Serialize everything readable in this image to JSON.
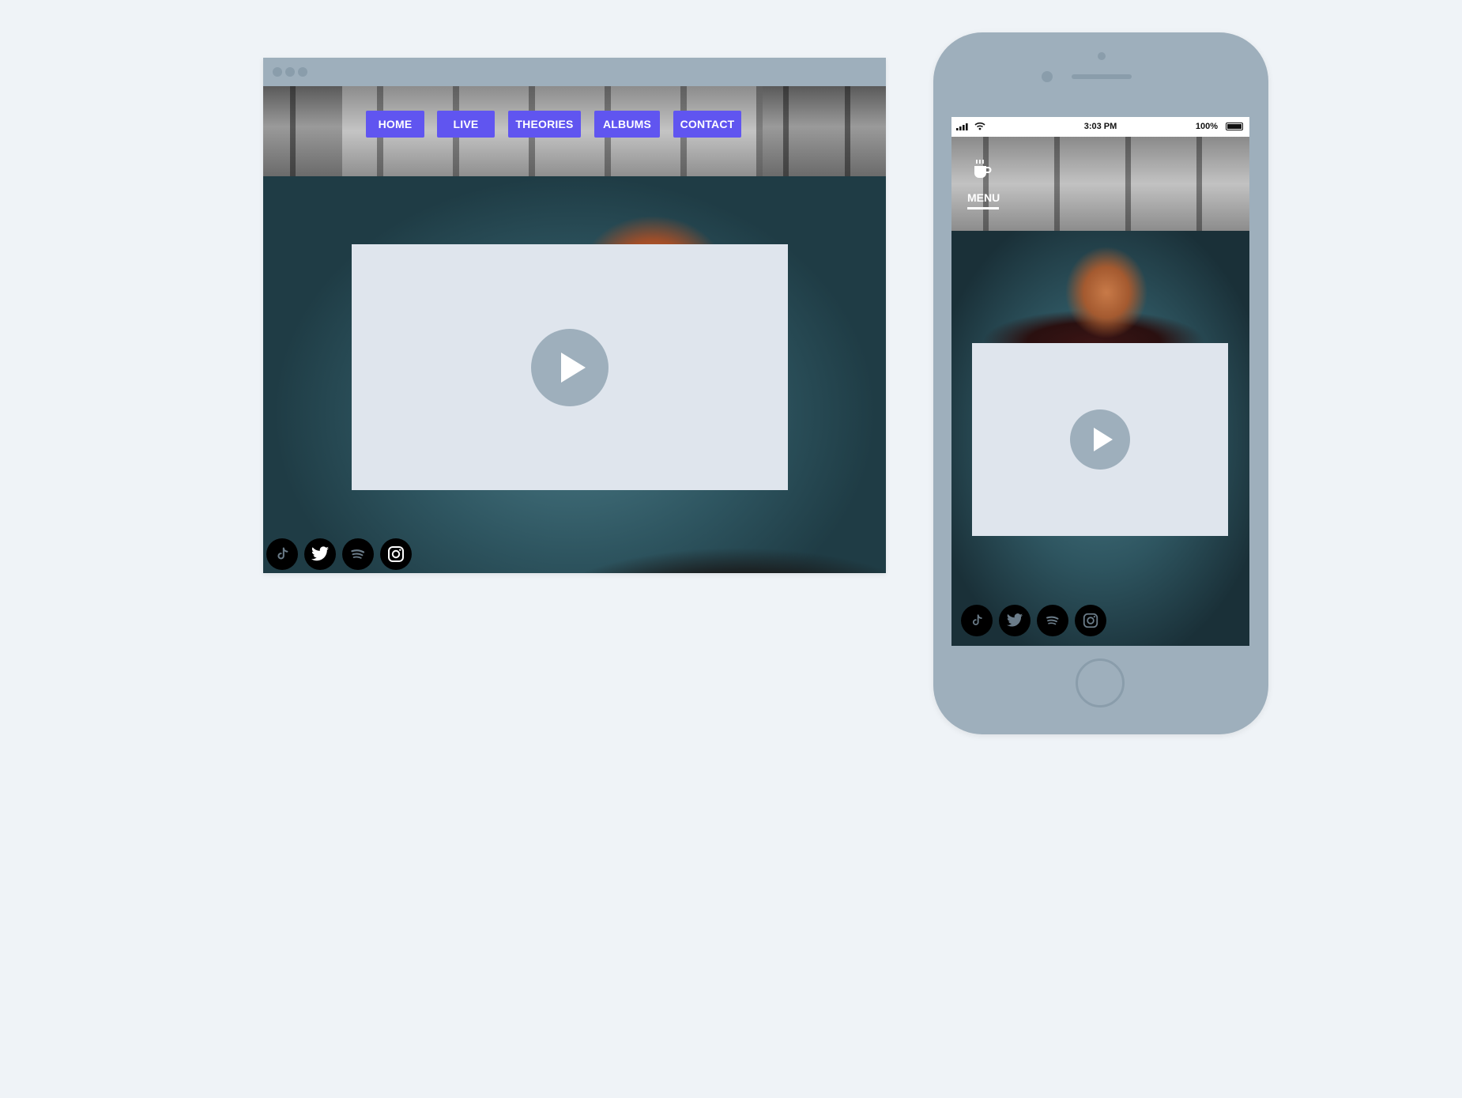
{
  "desktop": {
    "nav": [
      {
        "label": "HOME"
      },
      {
        "label": "LIVE"
      },
      {
        "label": "THEORIES"
      },
      {
        "label": "ALBUMS"
      },
      {
        "label": "CONTACT"
      }
    ],
    "video": {
      "icon": "play-icon"
    },
    "social": [
      "tiktok-icon",
      "twitter-icon",
      "spotify-icon",
      "instagram-icon"
    ]
  },
  "mobile": {
    "status": {
      "time": "3:03 PM",
      "battery": "100%"
    },
    "menu_label": "MENU",
    "video": {
      "icon": "play-icon"
    },
    "social": [
      "tiktok-icon",
      "twitter-icon",
      "spotify-icon",
      "instagram-icon"
    ]
  },
  "colors": {
    "background": "#eff3f7",
    "frame": "#9eafbc",
    "nav_accent": "#6055f0",
    "video_placeholder": "#dfe5ed"
  }
}
